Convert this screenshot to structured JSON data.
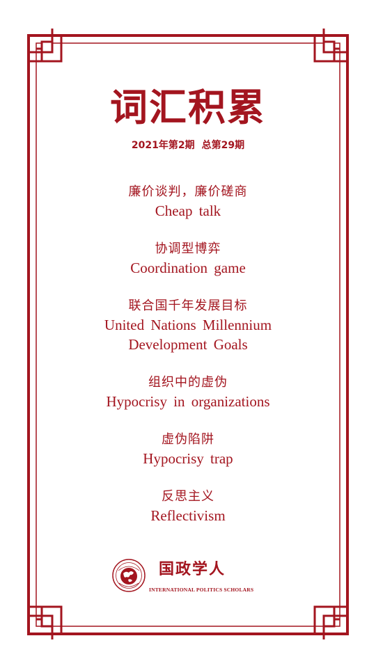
{
  "colors": {
    "accent": "#a3151f"
  },
  "header": {
    "title": "词汇积累",
    "issue_year": "2021年第2期",
    "issue_total": "总第29期"
  },
  "terms": [
    {
      "zh": "廉价谈判，廉价磋商",
      "en": "Cheap  talk"
    },
    {
      "zh": "协调型博弈",
      "en": "Coordination  game"
    },
    {
      "zh": "联合国千年发展目标",
      "en": "United  Nations  Millennium\nDevelopment  Goals"
    },
    {
      "zh": "组织中的虚伪",
      "en": "Hypocrisy  in  organizations"
    },
    {
      "zh": "虚伪陷阱",
      "en": "Hypocrisy  trap"
    },
    {
      "zh": "反思主义",
      "en": "Reflectivism"
    }
  ],
  "footer": {
    "logo_zh": "国政学人",
    "logo_en": "INTERNATIONAL POLITICS SCHOLARS",
    "emblem_icon": "globe-emblem-icon"
  }
}
